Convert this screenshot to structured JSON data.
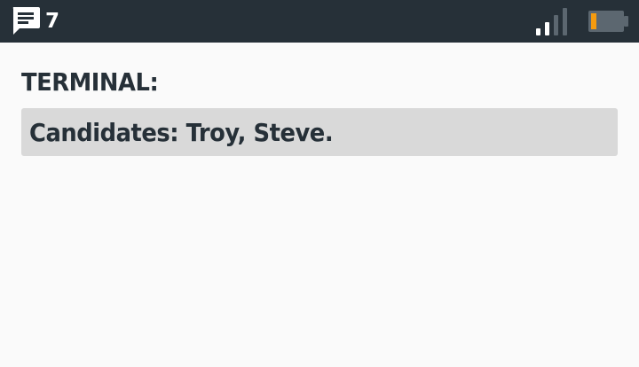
{
  "status_bar": {
    "message_count": "7",
    "icons": {
      "messages": "message-icon",
      "signal": "signal-strength-icon",
      "battery": "battery-icon"
    },
    "colors": {
      "background": "#263038",
      "battery_level": "#f59b0f"
    }
  },
  "screen": {
    "label": "TERMINAL:",
    "candidates_text": "Candidates: Troy, Steve."
  }
}
